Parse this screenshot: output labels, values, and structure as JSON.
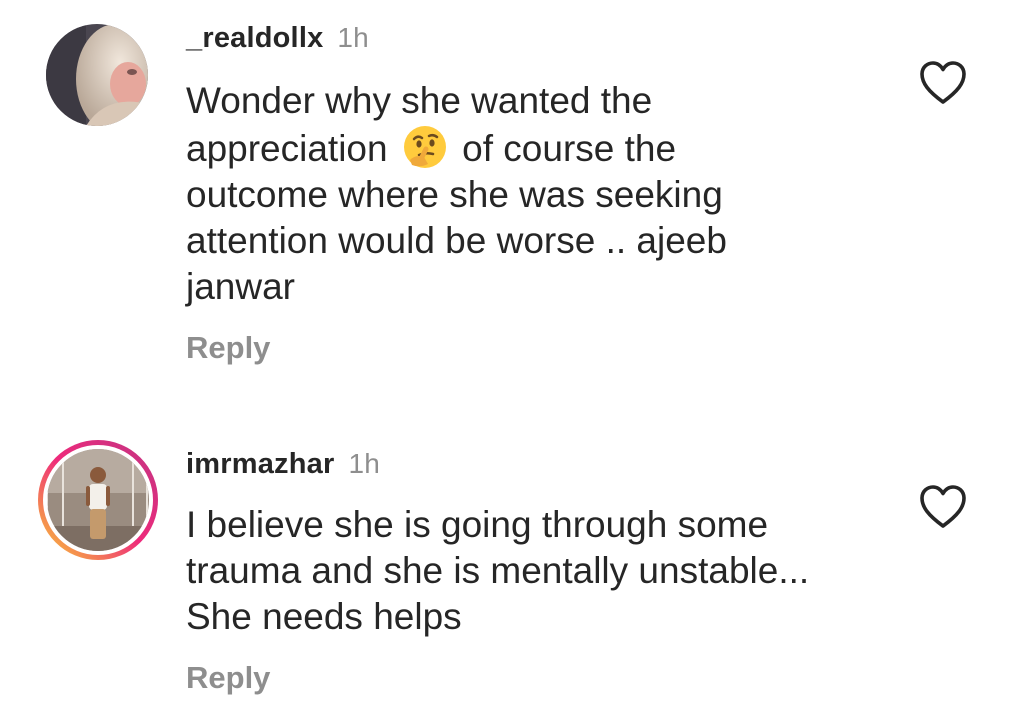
{
  "comments": [
    {
      "username": "_realdollx",
      "time": "1h",
      "text_before": "Wonder why she wanted the\nappreciation",
      "emoji": "thinking-face-emoji",
      "text_after": "of course the\noutcome where she was seeking\nattention would be worse .. ajeeb\njanwar",
      "reply_label": "Reply",
      "icon": "heart-outline-icon"
    },
    {
      "username": "imrmazhar",
      "time": "1h",
      "text": "I believe she is going through some\ntrauma and she is mentally unstable...\nShe needs helps",
      "reply_label": "Reply",
      "icon": "heart-outline-icon",
      "story_ring": true
    }
  ],
  "colors": {
    "text": "#262626",
    "muted": "#8e8e8e",
    "story_ring_start": "#f9ce34",
    "story_ring_mid": "#ee2a7b",
    "story_ring_end": "#c13584"
  }
}
